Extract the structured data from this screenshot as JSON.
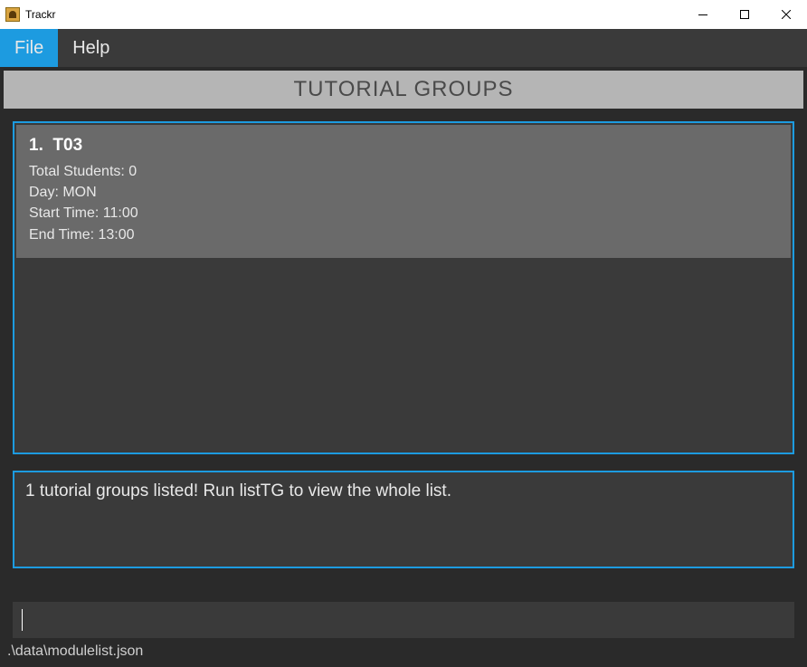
{
  "window": {
    "title": "Trackr"
  },
  "menubar": {
    "file": "File",
    "help": "Help"
  },
  "section": {
    "header": "TUTORIAL GROUPS"
  },
  "groups": [
    {
      "index": "1.",
      "name": "T03",
      "total_students_label": "Total Students: 0",
      "day_label": "Day: MON",
      "start_label": "Start Time: 11:00",
      "end_label": "End Time: 13:00"
    }
  ],
  "result": {
    "message": "1 tutorial groups listed! Run listTG to view the whole list."
  },
  "command": {
    "value": "",
    "placeholder": ""
  },
  "statusbar": {
    "path": ".\\data\\modulelist.json"
  }
}
